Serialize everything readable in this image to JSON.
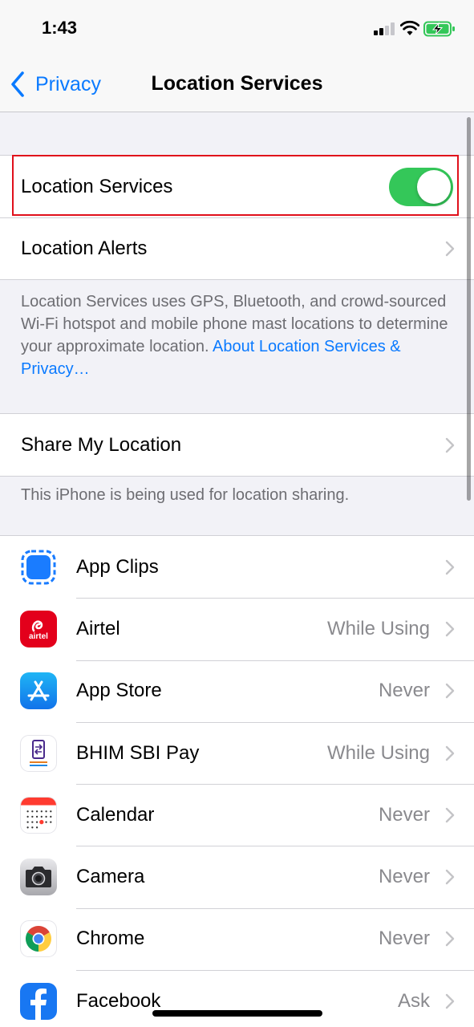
{
  "status_bar": {
    "time": "1:43"
  },
  "nav": {
    "back_label": "Privacy",
    "title": "Location Services"
  },
  "location_services": {
    "label": "Location Services",
    "enabled": true
  },
  "location_alerts": {
    "label": "Location Alerts"
  },
  "description": {
    "text": "Location Services uses GPS, Bluetooth, and crowd-sourced Wi-Fi hotspot and mobile phone mast locations to determine your approximate location. ",
    "link": "About Location Services & Privacy…"
  },
  "share_my_location": {
    "label": "Share My Location"
  },
  "sharing_note": "This iPhone is being used for location sharing.",
  "apps": [
    {
      "name": "App Clips",
      "value": "",
      "icon": "app-clips-icon"
    },
    {
      "name": "Airtel",
      "value": "While Using",
      "icon": "airtel-icon"
    },
    {
      "name": "App Store",
      "value": "Never",
      "icon": "app-store-icon"
    },
    {
      "name": "BHIM SBI Pay",
      "value": "While Using",
      "icon": "bhim-sbi-pay-icon"
    },
    {
      "name": "Calendar",
      "value": "Never",
      "icon": "calendar-icon"
    },
    {
      "name": "Camera",
      "value": "Never",
      "icon": "camera-icon"
    },
    {
      "name": "Chrome",
      "value": "Never",
      "icon": "chrome-icon"
    },
    {
      "name": "Facebook",
      "value": "Ask",
      "icon": "facebook-icon"
    }
  ],
  "icon_labels": {
    "airtel": "airtel"
  },
  "colors": {
    "accent": "#0a7aff",
    "toggle_on": "#34c759",
    "highlight": "#e0101b"
  }
}
